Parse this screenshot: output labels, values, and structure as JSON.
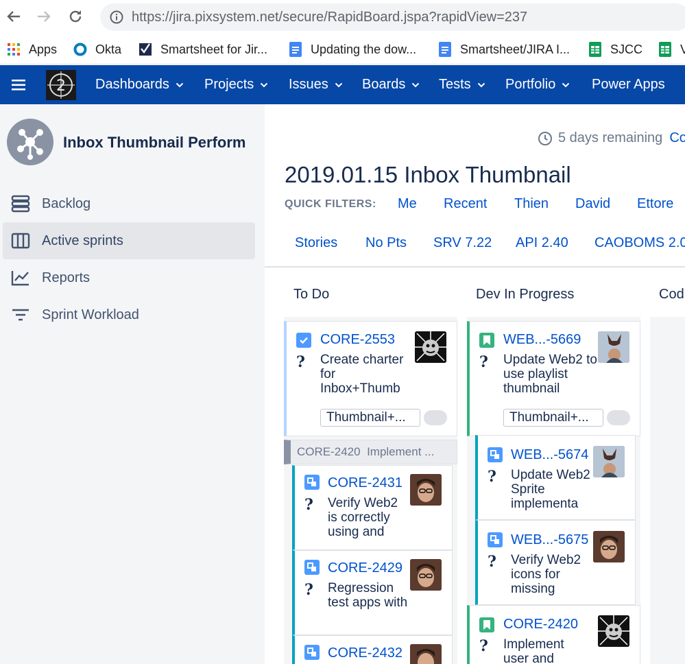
{
  "browser": {
    "url_host": "https://jira.pixsystem.net",
    "url_path": "/secure/RapidBoard.jspa?rapidView=237",
    "bookmarks": [
      {
        "label": "Apps",
        "icon": "apps-grid-icon"
      },
      {
        "label": "Okta",
        "icon": "okta-icon"
      },
      {
        "label": "Smartsheet for Jir...",
        "icon": "smartsheet-icon"
      },
      {
        "label": "Updating the dow...",
        "icon": "google-doc-icon"
      },
      {
        "label": "Smartsheet/JIRA I...",
        "icon": "google-doc-icon"
      },
      {
        "label": "SJCC",
        "icon": "google-sheet-icon"
      },
      {
        "label": "V",
        "icon": "google-sheet-icon"
      }
    ]
  },
  "topnav": {
    "items": [
      {
        "label": "Dashboards"
      },
      {
        "label": "Projects"
      },
      {
        "label": "Issues"
      },
      {
        "label": "Boards"
      },
      {
        "label": "Tests"
      },
      {
        "label": "Portfolio"
      },
      {
        "label": "Power Apps"
      }
    ]
  },
  "sidebar": {
    "project_name": "Inbox Thumbnail Perform",
    "items": [
      {
        "label": "Backlog",
        "icon": "backlog-icon"
      },
      {
        "label": "Active sprints",
        "icon": "board-columns-icon"
      },
      {
        "label": "Reports",
        "icon": "reports-chart-icon"
      },
      {
        "label": "Sprint Workload",
        "icon": "filter-lines-icon"
      }
    ]
  },
  "main": {
    "remaining": "5 days remaining",
    "remaining_suffix": "Co",
    "sprint_title": "2019.01.15 Inbox Thumbnail",
    "quick_filters_label": "QUICK FILTERS:",
    "quick_filters_row1": [
      "Me",
      "Recent",
      "Thien",
      "David",
      "Ettore"
    ],
    "quick_filters_row2": [
      "Stories",
      "No Pts",
      "SRV 7.22",
      "API 2.40",
      "CAOBOMS 2.0"
    ],
    "columns": [
      "To Do",
      "Dev In Progress",
      "Cod"
    ],
    "cards": {
      "todo1": {
        "key": "CORE-2553",
        "summary": "Create charter for Inbox+Thumb",
        "epic": "Thumbnail+..."
      },
      "subtask_header": {
        "key": "CORE-2420",
        "summary": "Implement ..."
      },
      "todo2": {
        "key": "CORE-2431",
        "summary": "Verify Web2 is correctly using and"
      },
      "todo3": {
        "key": "CORE-2429",
        "summary": "Regression test apps with"
      },
      "todo4": {
        "key": "CORE-2432",
        "summary": ""
      },
      "dev1": {
        "key": "WEB...-5669",
        "summary": "Update Web2 to use playlist thumbnail",
        "epic": "Thumbnail+..."
      },
      "dev2": {
        "key": "WEB...-5674",
        "summary": "Update Web2 Sprite implementa"
      },
      "dev3": {
        "key": "WEB...-5675",
        "summary": "Verify Web2 icons for missing"
      },
      "dev4": {
        "key": "CORE-2420",
        "summary": "Implement user and"
      }
    }
  }
}
